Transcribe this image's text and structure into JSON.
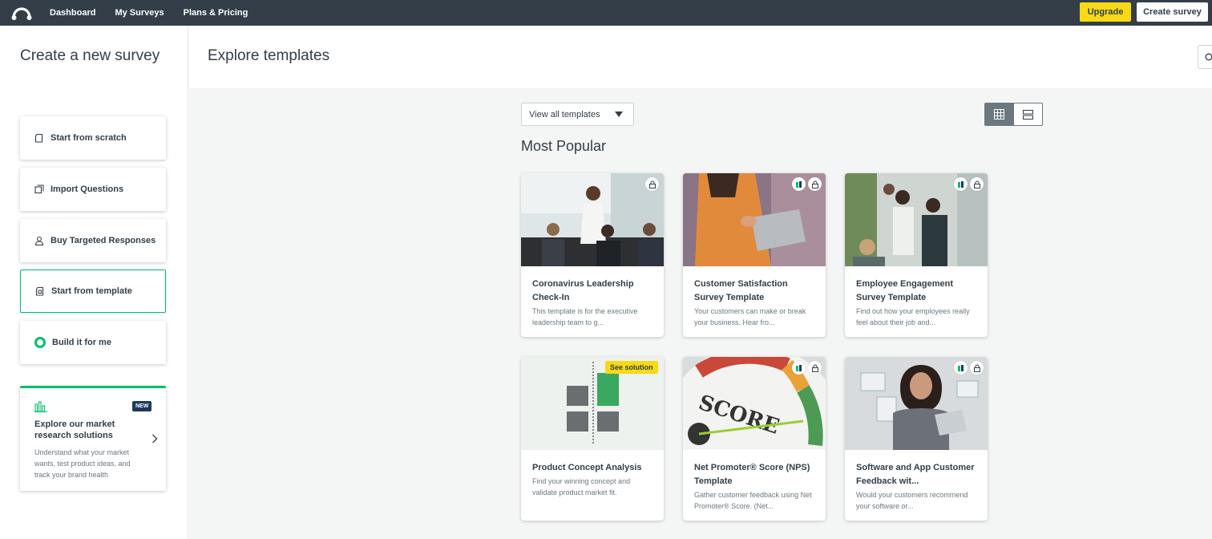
{
  "topbar": {
    "logo_icon": "surveymonkey-logo-icon",
    "nav": [
      "Dashboard",
      "My Surveys",
      "Plans & Pricing"
    ],
    "upgrade_label": "Upgrade",
    "create_label": "Create survey"
  },
  "sidebar": {
    "title": "Create a new survey",
    "options": [
      {
        "label": "Start from scratch",
        "icon": "blank-page-icon"
      },
      {
        "label": "Import Questions",
        "icon": "copy-pages-icon"
      },
      {
        "label": "Buy Targeted Responses",
        "icon": "person-icon"
      },
      {
        "label": "Start from template",
        "icon": "template-page-icon",
        "active": true
      },
      {
        "label": "Build it for me",
        "icon": "ring-icon"
      }
    ],
    "promo": {
      "badge": "NEW",
      "title": "Explore our market research solutions",
      "description": "Understand what your market wants, test product ideas, and track your brand health"
    }
  },
  "main": {
    "title": "Explore templates",
    "filter_value": "View all templates",
    "section_title": "Most Popular",
    "cards": [
      {
        "title": "Coronavirus Leadership Check-In",
        "description": "This template is for the executive leadership team to g...",
        "badges": [
          "lock-icon"
        ]
      },
      {
        "title": "Customer Satisfaction Survey Template",
        "description": "Your customers can make or break your business. Hear fro...",
        "badges": [
          "benchmark-icon",
          "lock-icon"
        ]
      },
      {
        "title": "Employee Engagement Survey Template",
        "description": "Find out how your employees really feel about their job and...",
        "badges": [
          "benchmark-icon",
          "lock-icon"
        ]
      },
      {
        "title": "Product Concept Analysis",
        "description": "Find your winning concept and validate product market fit.",
        "tag": "See solution"
      },
      {
        "title": "Net Promoter® Score (NPS) Template",
        "description": "Gather customer feedback using Net Promoter® Score. (Net...",
        "badges": [
          "benchmark-icon",
          "lock-icon"
        ],
        "image_text": "SCORE"
      },
      {
        "title": "Software and App Customer Feedback wit...",
        "description": "Would your customers recommend your software or...",
        "badges": [
          "benchmark-icon",
          "lock-icon"
        ]
      }
    ]
  },
  "colors": {
    "topbar": "#333e48",
    "accent_green": "#00bf6f",
    "upgrade_yellow": "#f7d916",
    "body_bg": "#f4f5f5"
  }
}
